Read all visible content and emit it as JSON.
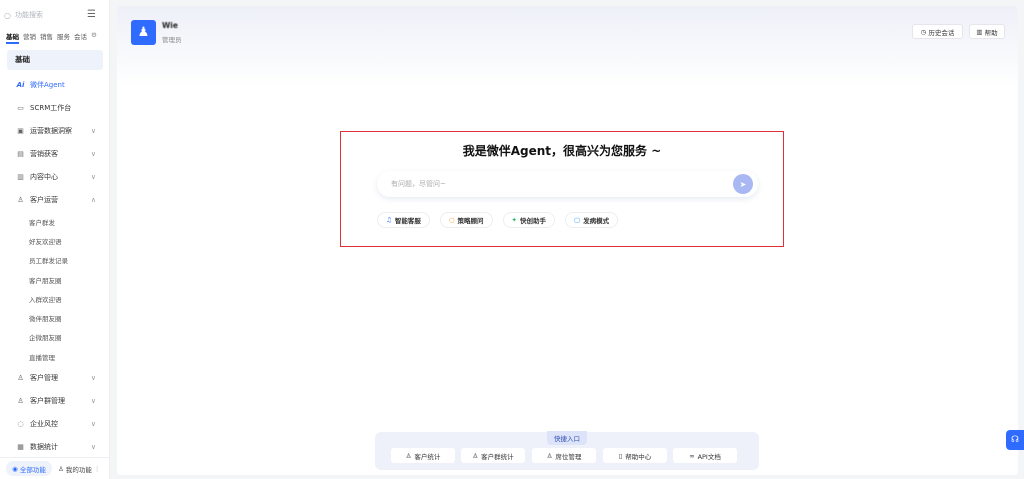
{
  "sidebar": {
    "search_placeholder": "功能搜索",
    "tabs": [
      "基础",
      "营销",
      "销售",
      "服务",
      "会话"
    ],
    "section_title": "基础",
    "items": [
      {
        "label": "微伴Agent",
        "icon": "ai-icon"
      },
      {
        "label": "SCRM工作台",
        "icon": "monitor-icon"
      },
      {
        "label": "运营数据洞察",
        "icon": "chart-icon"
      },
      {
        "label": "营销获客",
        "icon": "marketing-icon"
      },
      {
        "label": "内容中心",
        "icon": "document-icon"
      },
      {
        "label": "客户运营",
        "icon": "user-icon"
      },
      {
        "label": "客户管理",
        "icon": "users-icon"
      },
      {
        "label": "客户群管理",
        "icon": "group-icon"
      },
      {
        "label": "企业风控",
        "icon": "shield-icon"
      },
      {
        "label": "数据统计",
        "icon": "stats-icon"
      }
    ],
    "sub_items": [
      "客户群发",
      "好友欢迎语",
      "员工群发记录",
      "客户朋友圈",
      "入群欢迎语",
      "微伴朋友圈",
      "企微朋友圈",
      "直播管理"
    ],
    "bottom": {
      "all": "全部功能",
      "mine": "我的功能"
    }
  },
  "header": {
    "user_name": "Wie",
    "user_role": "管理员",
    "history_label": "历史会话",
    "help_label": "帮助"
  },
  "agent": {
    "headline": "我是微伴Agent，很高兴为您服务 ~",
    "input_placeholder": "有问题，尽管问~",
    "chips": [
      "智能客服",
      "策略顾问",
      "快创助手",
      "发病模式"
    ]
  },
  "quick": {
    "title": "快捷入口",
    "items": [
      "客户统计",
      "客户群统计",
      "席位管理",
      "帮助中心",
      "API文档"
    ]
  },
  "colors": {
    "accent": "#2f6bff",
    "highlight_border": "#e0303a"
  }
}
